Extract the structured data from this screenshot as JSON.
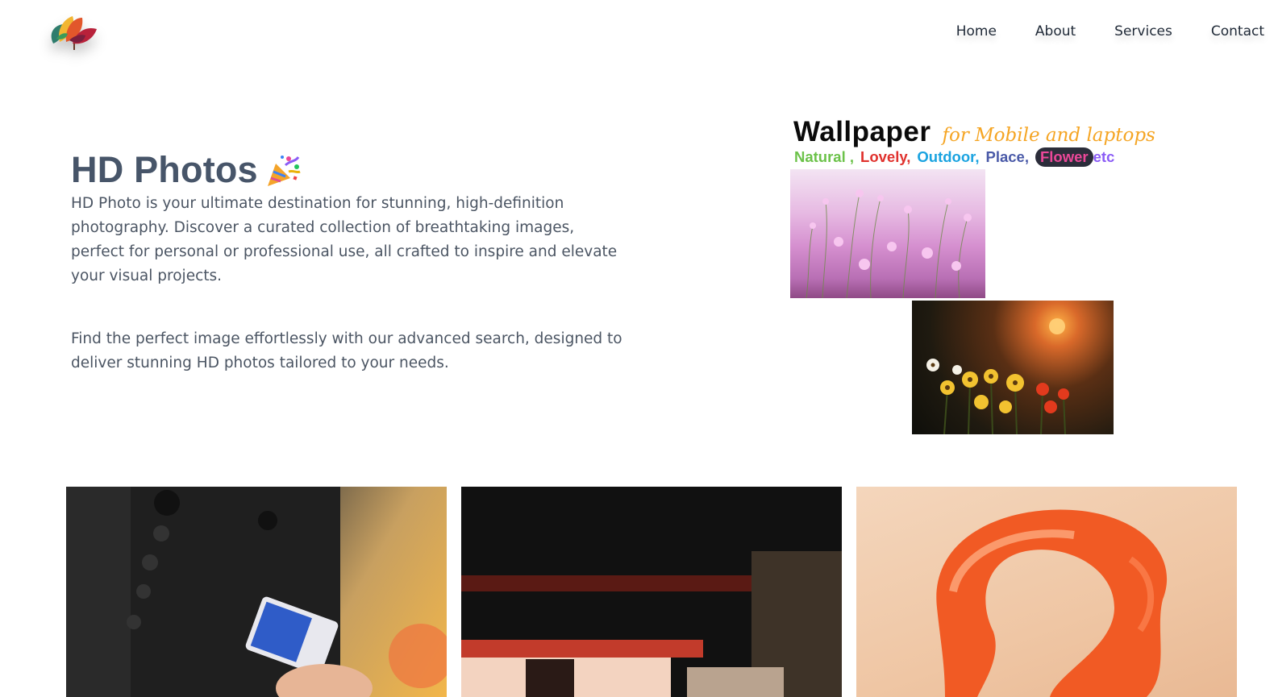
{
  "header": {
    "nav": [
      "Home",
      "About",
      "Services",
      "Contact"
    ]
  },
  "hero": {
    "title": "HD Photos",
    "paragraph1": "HD Photo is your ultimate destination for stunning, high-definition photography. Discover a curated collection of breathtaking images, perfect for personal or professional use, all crafted to inspire and elevate your visual projects.",
    "paragraph2": "Find the perfect image effortlessly with our advanced search, designed to deliver stunning HD photos tailored to your needs."
  },
  "promo": {
    "heading": "Wallpaper",
    "subheading": "for Mobile and laptops",
    "tags": [
      {
        "text": "Natural ,",
        "color": "#6cc24a"
      },
      {
        "text": "Lovely,",
        "color": "#e0312d"
      },
      {
        "text": "Outdoor,",
        "color": "#1aa3e0"
      },
      {
        "text": "Place,",
        "color": "#4a5aa8"
      },
      {
        "text": "Flower",
        "color": "#ec4899"
      },
      {
        "text": "etc",
        "color": "#8b5cf6"
      }
    ]
  },
  "icons": {
    "logo": "autumn-leaves-logo-icon",
    "title_emoji": "party-popper-icon"
  },
  "colors": {
    "title": "#475569",
    "body_text": "#4b5563",
    "nav_text": "#1f2937",
    "script_accent": "#f5a524"
  }
}
